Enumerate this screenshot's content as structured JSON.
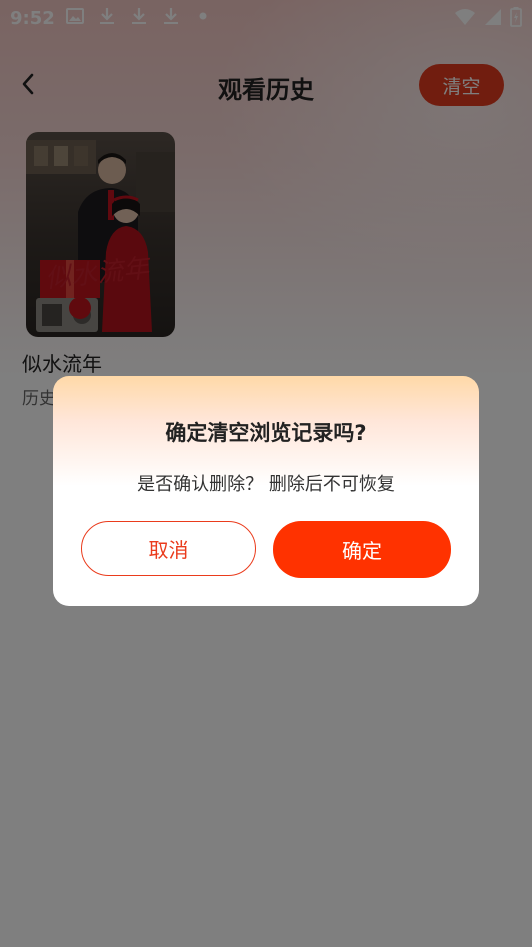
{
  "status_bar": {
    "time": "9:52",
    "left_icons": [
      "image-icon",
      "download-icon",
      "download-icon",
      "download-icon",
      "dot-icon"
    ],
    "right_icons": [
      "wifi-icon",
      "signal-icon",
      "battery-icon"
    ]
  },
  "header": {
    "title": "观看历史",
    "clear_label": "清空",
    "back_icon": "chevron-left-icon"
  },
  "history": {
    "items": [
      {
        "title": "似水流年",
        "subtitle": "历史",
        "cover_text": "似水流年"
      }
    ]
  },
  "dialog": {
    "title": "确定清空浏览记录吗?",
    "message": "是否确认删除？ 删除后不可恢复",
    "cancel_label": "取消",
    "confirm_label": "确定"
  },
  "colors": {
    "accent": "#ff3200",
    "clear_button": "#e23b1e",
    "overlay": "rgba(0,0,0,0.5)"
  }
}
